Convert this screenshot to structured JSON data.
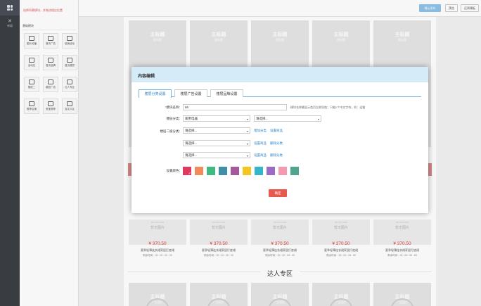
{
  "rail": {
    "items": [
      {
        "label": ""
      },
      {
        "label": "布局"
      }
    ]
  },
  "panel": {
    "tip": "选择所需模块，并拖进相应位置",
    "section": "基础模块",
    "widgets": [
      {
        "label": "图片轮播"
      },
      {
        "label": "首页广告"
      },
      {
        "label": "促销活动"
      },
      {
        "label": "活动位"
      },
      {
        "label": "首页品牌"
      },
      {
        "label": "首页楼层"
      },
      {
        "label": "楼层二"
      },
      {
        "label": "楼层广告"
      },
      {
        "label": "达人专区"
      },
      {
        "label": "推荐店铺"
      },
      {
        "label": "逛宝推荐"
      },
      {
        "label": "自定义区"
      }
    ]
  },
  "topbar": {
    "publish": "确认发布",
    "preview": "预览",
    "restore": "还原模板"
  },
  "canvas": {
    "tiles": [
      {
        "title": "主标题",
        "subtitle": "副标题"
      },
      {
        "title": "主标题",
        "subtitle": "副标题"
      },
      {
        "title": "主标题",
        "subtitle": "副标题"
      },
      {
        "title": "主标题",
        "subtitle": "副标题"
      },
      {
        "title": "主标题",
        "subtitle": "副标题"
      }
    ],
    "products": [
      {
        "placeholder": "暂无图片",
        "placeholder_small": "NO PICTURE",
        "price": "¥ 370.50",
        "name": "夏季轻薄连衣裙家居打底裙",
        "time": "剩余时间：00 : 00 : 00 : 00"
      },
      {
        "placeholder": "暂无图片",
        "placeholder_small": "NO PICTURE",
        "price": "¥ 370.50",
        "name": "夏季轻薄连衣裙家居打底裙",
        "time": "剩余时间：00 : 00 : 00 : 00"
      },
      {
        "placeholder": "暂无图片",
        "placeholder_small": "NO PICTURE",
        "price": "¥ 370.50",
        "name": "夏季轻薄连衣裙家居打底裙",
        "time": "剩余时间：00 : 00 : 00 : 00"
      },
      {
        "placeholder": "暂无图片",
        "placeholder_small": "NO PICTURE",
        "price": "¥ 370.50",
        "name": "夏季轻薄连衣裙家居打底裙",
        "time": "剩余时间：00 : 00 : 00 : 00"
      },
      {
        "placeholder": "暂无图片",
        "placeholder_small": "NO PICTURE",
        "price": "¥ 370.50",
        "name": "夏季轻薄连衣裙家居打底裙",
        "time": "剩余时间：00 : 00 : 00 : 00"
      }
    ],
    "talent_title": "达人专区",
    "bottom_tiles": [
      {
        "title": "主标题",
        "subtitle": "广告图片"
      },
      {
        "title": "主标题",
        "subtitle": "广告图片"
      },
      {
        "title": "主标题",
        "subtitle": "广告图片"
      },
      {
        "title": "主标题",
        "subtitle": "广告图片"
      },
      {
        "title": "主标题",
        "subtitle": "广告图片"
      }
    ]
  },
  "modal": {
    "title": "内容编辑",
    "tabs": [
      "楼层分类设置",
      "楼层广告设置",
      "楼层品牌设置"
    ],
    "active_tab": 0,
    "module_name_label": "模块名称：",
    "module_name_value": "66",
    "module_name_hint": "模块名称最显示首页左侧导航；只能2个中文字符，如：运猫",
    "floor_cat_label": "楼层分类：",
    "floor_cat_value": "家用电器",
    "floor_cat_second": "请选择...",
    "floor_sub_label": "楼层二级分类：",
    "sub_rows": [
      {
        "value": "请选择...",
        "links": [
          "增加分类",
          "设置商品"
        ]
      },
      {
        "value": "请选择...",
        "links": [
          "设置商品",
          "删除分类"
        ]
      },
      {
        "value": "请选择...",
        "links": [
          "设置商品",
          "删除分类"
        ]
      }
    ],
    "color_label": "设置颜色：",
    "colors": [
      "#e0395f",
      "#f28b5b",
      "#40b983",
      "#3f8fa8",
      "#a45a9a",
      "#f4c421",
      "#35b5c8",
      "#9b6ac4",
      "#f49ab0",
      "#4fa58d"
    ],
    "selected_color": 0,
    "confirm": "确定"
  }
}
